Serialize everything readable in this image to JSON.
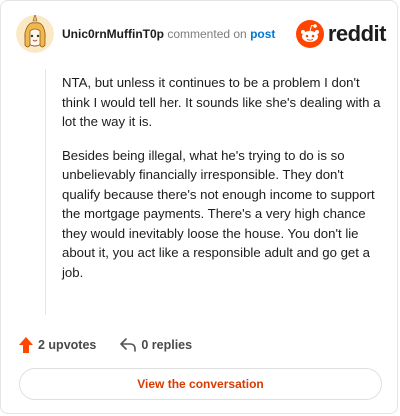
{
  "header": {
    "username": "Unic0rnMuffinT0p",
    "action": "commented on",
    "link": "post",
    "brand": "reddit"
  },
  "comment": {
    "paragraphs": [
      "NTA, but unless it continues to be a problem I don't think I would tell her. It sounds like she's dealing with a lot the way it is.",
      "Besides being illegal, what he's trying to do is so unbelievably financially irresponsible. They don't qualify because there's not enough income to support the mortgage payments. There's a very high chance they would inevitably loose the house. You don't lie about it, you act like a responsible adult and go get a job."
    ]
  },
  "footer": {
    "upvotes_label": "2 upvotes",
    "replies_label": "0 replies",
    "cta_label": "View the conversation"
  },
  "colors": {
    "reddit_orange": "#ff4500",
    "cta_text": "#d93a00",
    "link_blue": "#0079d3"
  },
  "icons": {
    "avatar": "avatar",
    "logo": "reddit-snoo-icon",
    "upvote": "upvote-arrow-icon",
    "reply": "reply-arrow-icon"
  }
}
